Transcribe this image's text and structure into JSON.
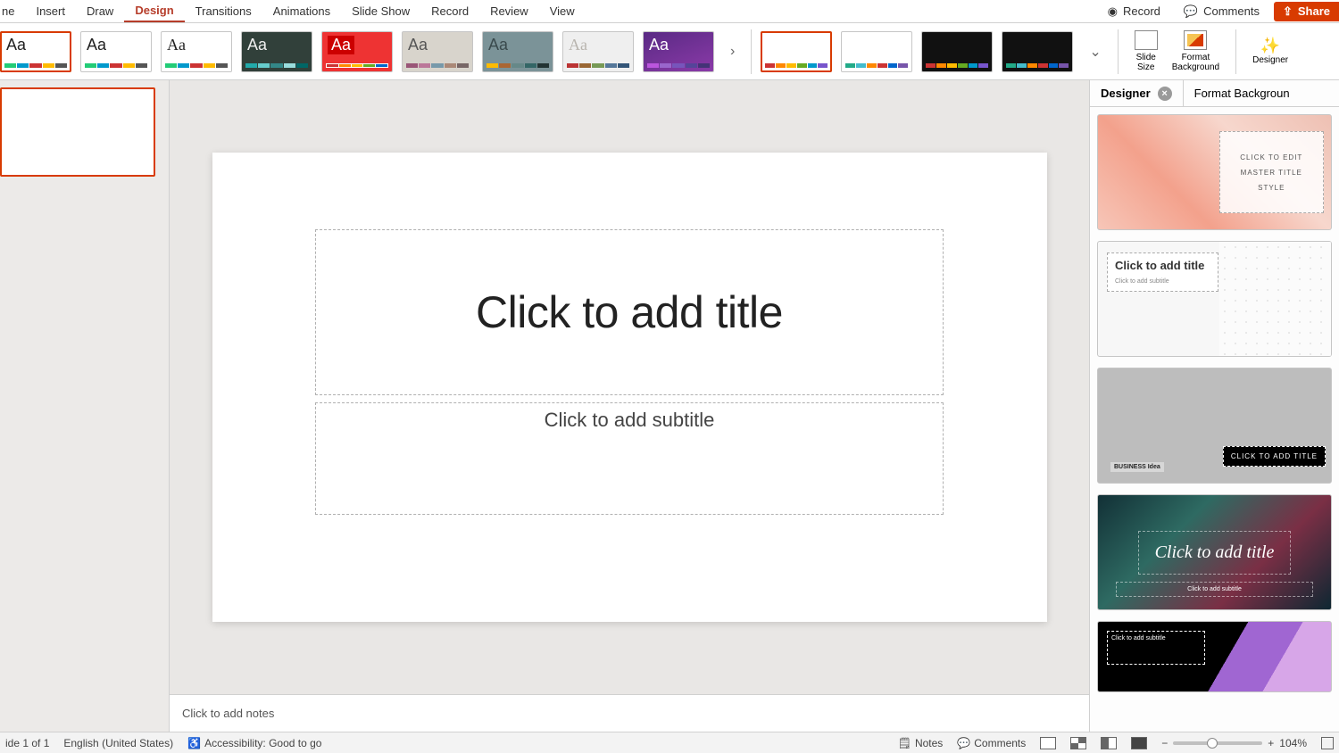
{
  "tabs": {
    "home_cut": "ne",
    "insert": "Insert",
    "draw": "Draw",
    "design": "Design",
    "transitions": "Transitions",
    "animations": "Animations",
    "slideshow": "Slide Show",
    "record": "Record",
    "review": "Review",
    "view": "View"
  },
  "titlebar": {
    "record": "Record",
    "comments": "Comments",
    "share": "Share"
  },
  "themes": {
    "aa": "Aa",
    "more": "›"
  },
  "tools": {
    "slide_size_l1": "Slide",
    "slide_size_l2": "Size",
    "format_bg_l1": "Format",
    "format_bg_l2": "Background",
    "designer": "Designer"
  },
  "side": {
    "designer": "Designer",
    "format_bg": "Format Backgroun",
    "close": "×",
    "card1_line1": "CLICK TO EDIT",
    "card1_line2": "MASTER TITLE",
    "card1_line3": "STYLE",
    "card2_title": "Click to add title",
    "card2_sub": "Click to add subtitle",
    "card3_badge": "CLICK TO ADD TITLE",
    "card3_sticker": "BUSINESS Idea",
    "card4_script": "Click to add title",
    "card4_sub": "Click to add subtitle",
    "card5_sub": "Click to add subtitle"
  },
  "slide": {
    "title_placeholder": "Click to add title",
    "subtitle_placeholder": "Click to add subtitle"
  },
  "notes": {
    "placeholder": "Click to add notes"
  },
  "status": {
    "slide_counter": "ide 1 of 1",
    "language": "English (United States)",
    "accessibility": "Accessibility: Good to go",
    "notes": "Notes",
    "comments": "Comments",
    "zoom_pct": "104%"
  },
  "glyph": {
    "record_dot": "◉",
    "comment": "💬",
    "share": "⇪",
    "notes": "🗒",
    "access": "♿",
    "minus": "−",
    "plus": "+",
    "sparkle": "✨",
    "chev": "⌄"
  }
}
